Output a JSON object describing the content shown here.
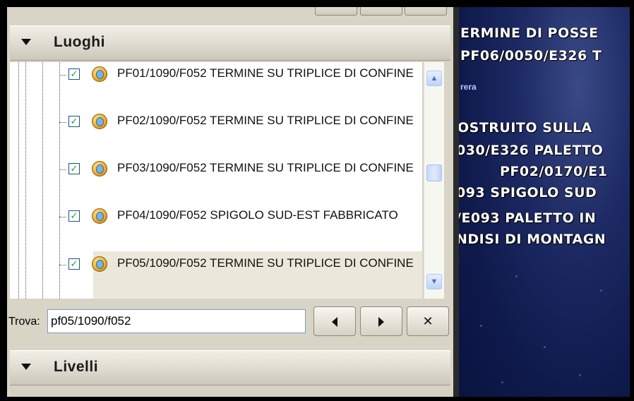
{
  "places_panel": {
    "title": "Luoghi",
    "items": [
      {
        "label": "PF01/1090/F052 TERMINE SU TRIPLICE DI CONFINE",
        "checked": true,
        "selected": false
      },
      {
        "label": "PF02/1090/F052 TERMINE SU TRIPLICE DI CONFINE",
        "checked": true,
        "selected": false
      },
      {
        "label": "PF03/1090/F052 TERMINE SU TRIPLICE DI CONFINE",
        "checked": true,
        "selected": false
      },
      {
        "label": "PF04/1090/F052 SPIGOLO SUD-EST FABBRICATO",
        "checked": true,
        "selected": false
      },
      {
        "label": "PF05/1090/F052 TERMINE SU TRIPLICE DI CONFINE",
        "checked": true,
        "selected": true
      }
    ]
  },
  "find": {
    "label": "Trova:",
    "value": "pf05/1090/f052"
  },
  "layers_panel": {
    "title": "Livelli"
  },
  "map": {
    "labels": [
      "ERMINE DI POSSE",
      "PF06/0050/E326 T",
      "rera",
      "OSTRUITO SULLA",
      "030/E326 PALETTO",
      "PF02/0170/E1",
      "093 SPIGOLO SUD",
      "/E093 PALETTO IN",
      "NDISI DI MONTAGN"
    ]
  },
  "icons": {
    "collapse": "triangle-down-icon",
    "checkbox": "checkbox-checked-icon",
    "place": "placemark-icon",
    "prev": "triangle-left-icon",
    "next": "triangle-right-icon",
    "close": "close-icon"
  }
}
